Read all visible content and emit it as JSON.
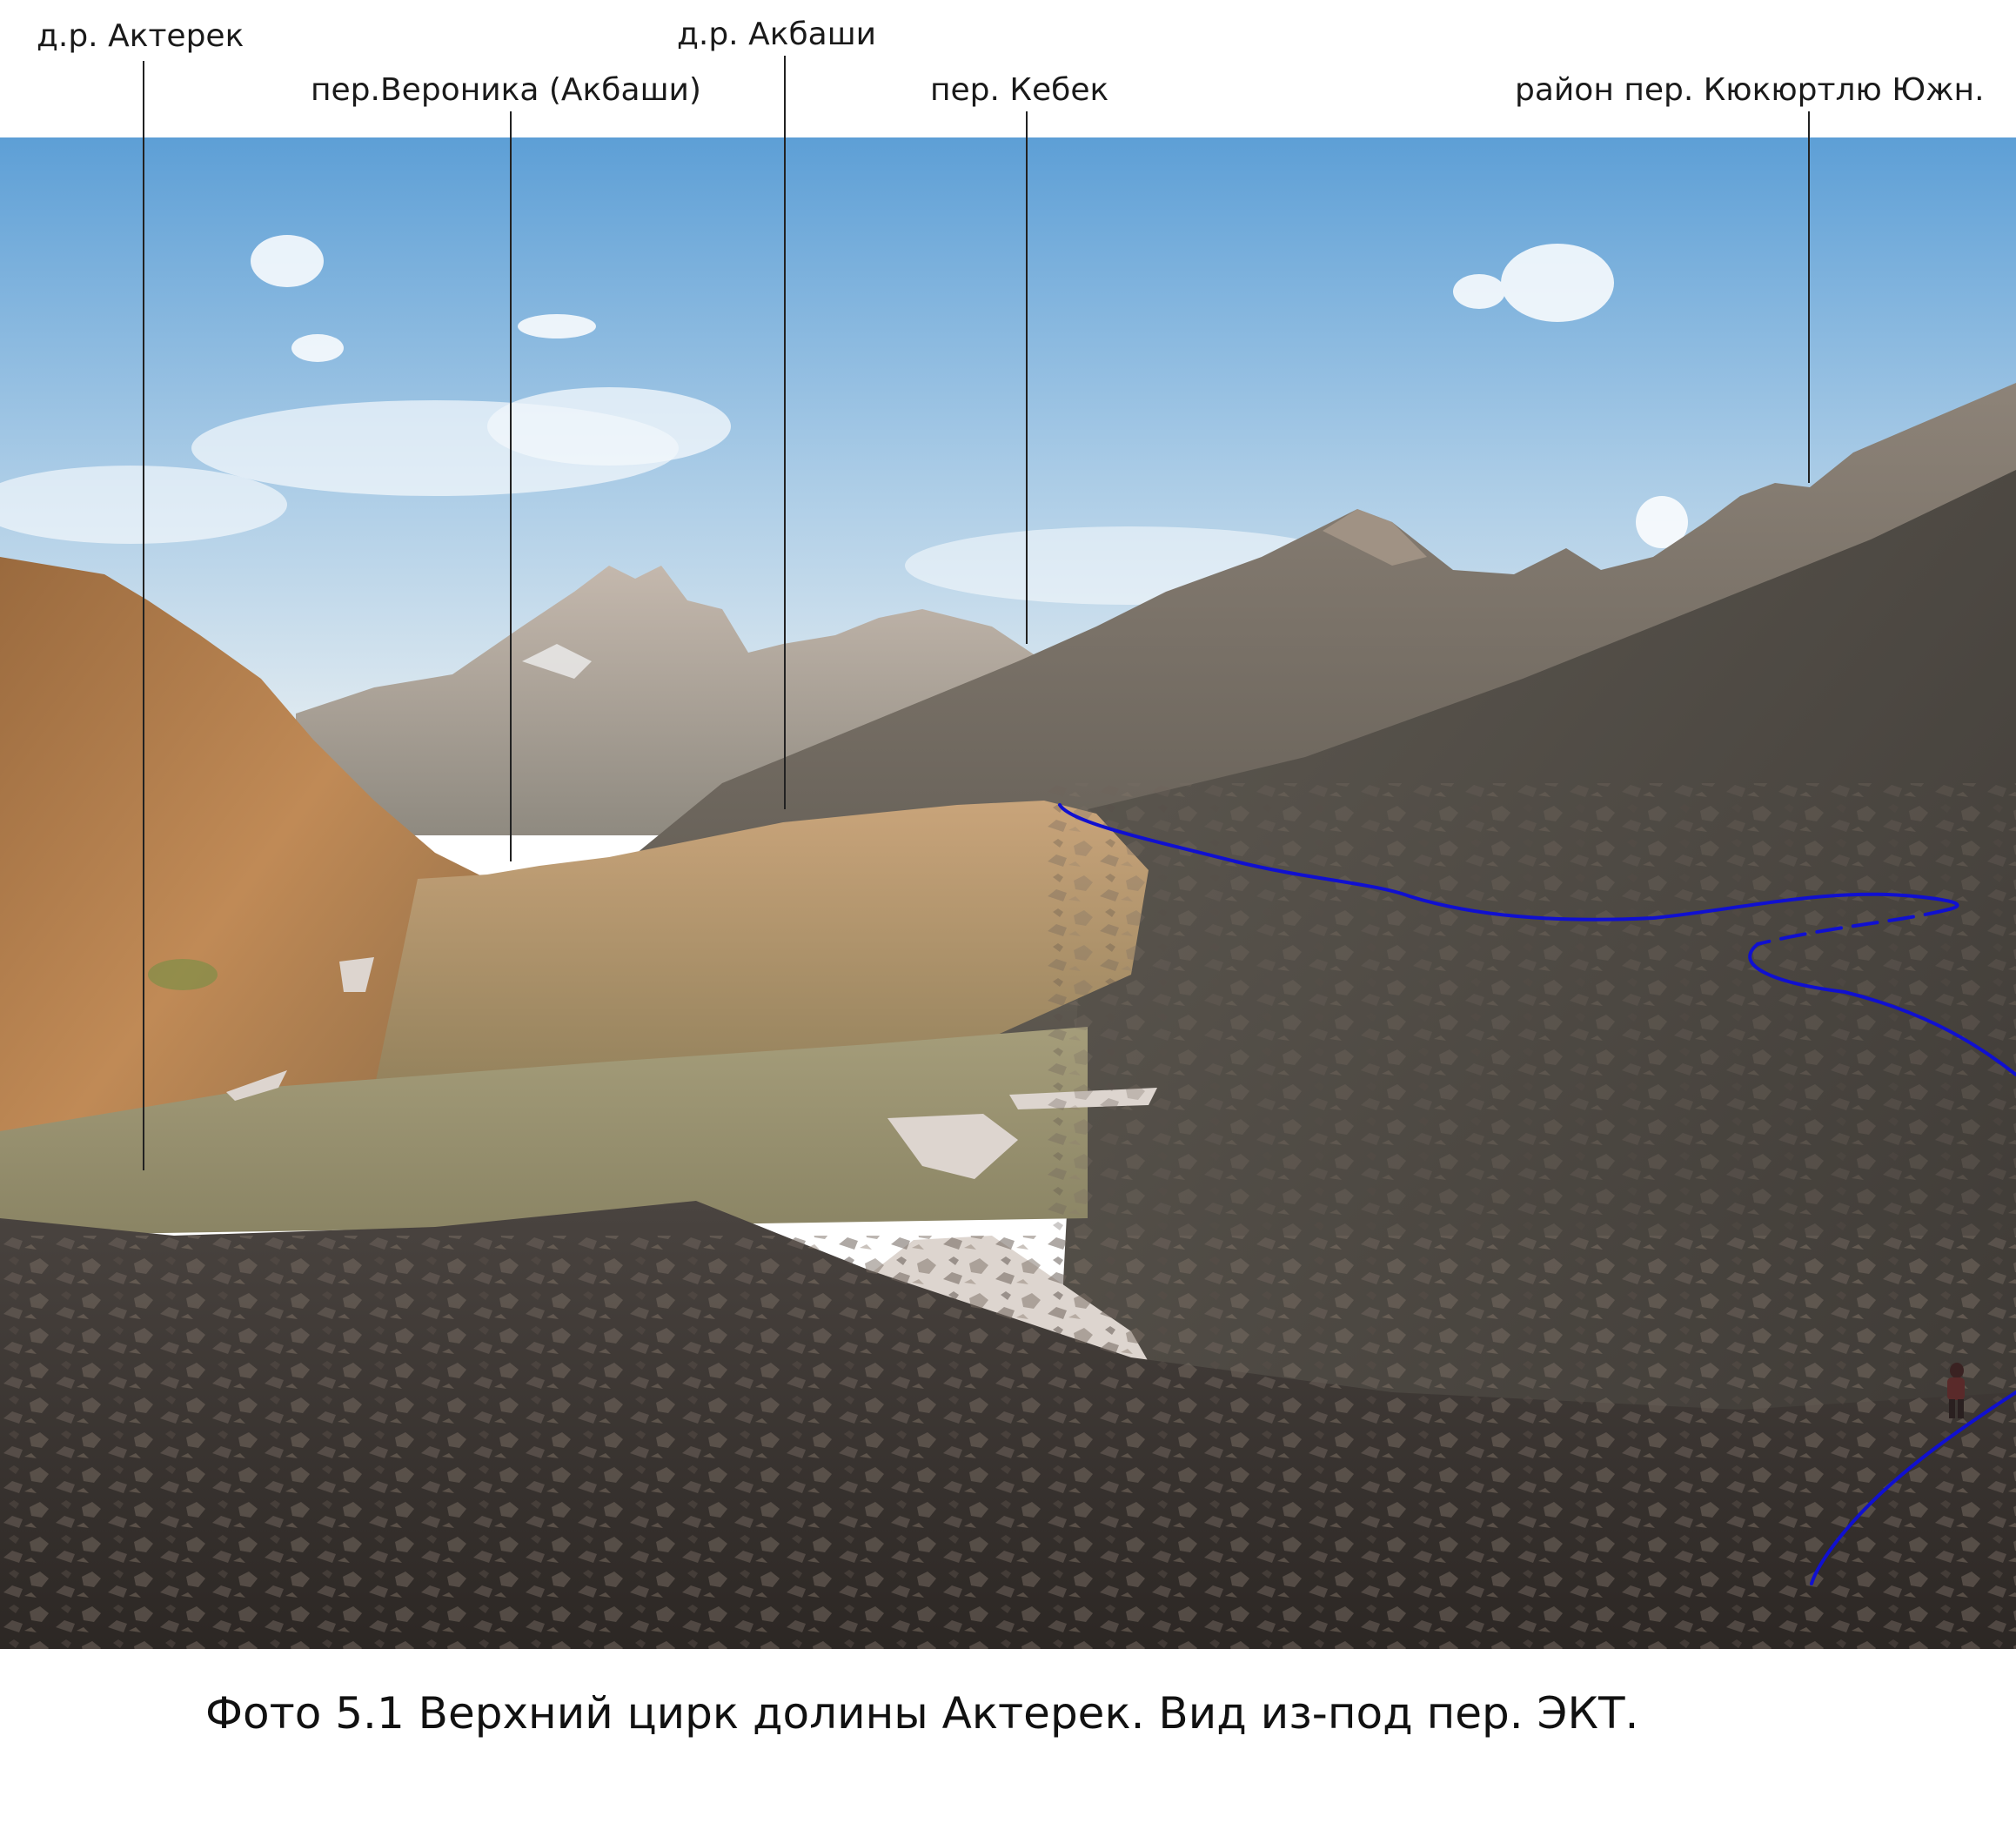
{
  "labels": {
    "akterek": "д.р. Актерек",
    "veronika": "пер.Вероника (Акбаши)",
    "akbashi": "д.р. Акбаши",
    "kebek": "пер. Кебек",
    "kyukyurtlyu": "район пер. Кюкюртлю Южн."
  },
  "caption": "Фото 5.1  Верхний цирк долины Актерек. Вид из-под пер. ЭКТ.",
  "colors": {
    "route": "#1010d0",
    "leader_line": "#222222",
    "sky_top": "#6aa6d8",
    "sky_bottom": "#dde9f2"
  }
}
